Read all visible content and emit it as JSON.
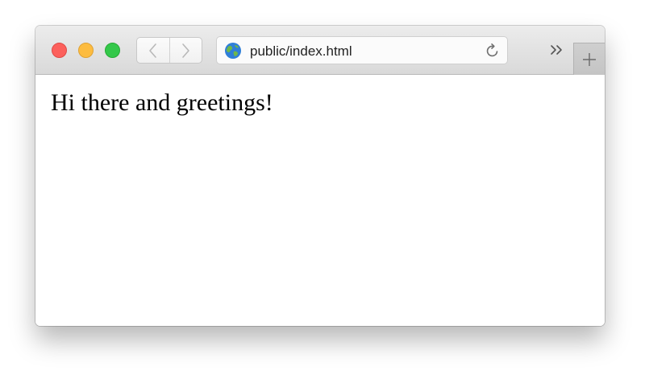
{
  "window": {
    "traffic_lights": {
      "close_color": "#fc605c",
      "minimize_color": "#fdbc40",
      "zoom_color": "#34c84a"
    }
  },
  "toolbar": {
    "back_icon": "chevron-left-icon",
    "forward_icon": "chevron-right-icon",
    "address": {
      "icon": "globe-icon",
      "url": "public/index.html",
      "reload_icon": "reload-icon"
    },
    "overflow_icon": "double-chevron-icon",
    "new_tab_icon": "plus-icon"
  },
  "page": {
    "body_text": "Hi there and greetings!"
  }
}
